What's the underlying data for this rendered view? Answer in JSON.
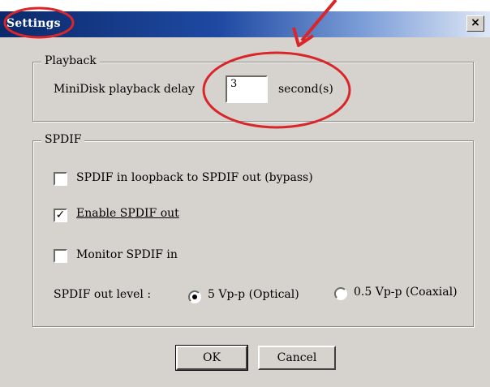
{
  "window": {
    "title": "Settings",
    "close_glyph": "×"
  },
  "playback": {
    "legend": "Playback",
    "delay_label": "MiniDisk playback delay",
    "delay_value": "3",
    "unit_label": "second(s)"
  },
  "spdif": {
    "legend": "SPDIF",
    "options": [
      {
        "label": "SPDIF in loopback to SPDIF out (bypass)",
        "checked": false
      },
      {
        "label": "Enable SPDIF out",
        "checked": true
      },
      {
        "label": "Monitor SPDIF in",
        "checked": false
      }
    ],
    "out_level_label": "SPDIF out level :",
    "radios": [
      {
        "label": "5 Vp-p (Optical)",
        "selected": true
      },
      {
        "label": "0.5 Vp-p (Coaxial)",
        "selected": false
      }
    ]
  },
  "buttons": {
    "ok": "OK",
    "cancel": "Cancel"
  },
  "annotation_color": "#d8262a"
}
